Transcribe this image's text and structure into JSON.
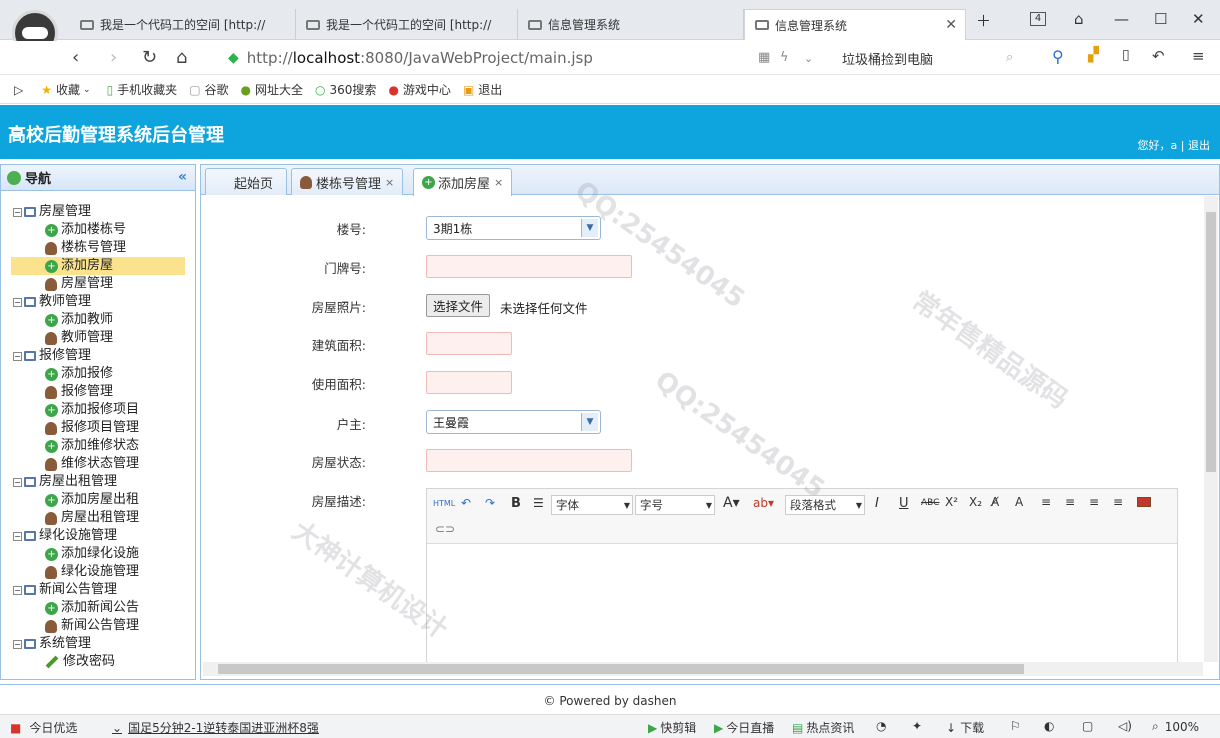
{
  "browser": {
    "tabs": [
      {
        "title": "我是一个代码工的空间 [http://"
      },
      {
        "title": "我是一个代码工的空间 [http://"
      },
      {
        "title": "信息管理系统"
      },
      {
        "title": "信息管理系统"
      }
    ],
    "tab_count": "4",
    "url_prefix": "http://",
    "url_host": "localhost",
    "url_rest": ":8080/JavaWebProject/main.jsp",
    "search_text": "垃圾桶捡到电脑"
  },
  "bookmarks": [
    "收藏",
    "手机收藏夹",
    "谷歌",
    "网址大全",
    "360搜索",
    "游戏中心",
    "退出"
  ],
  "app": {
    "title": "高校后勤管理系统后台管理",
    "user_info": "您好，a | 退出"
  },
  "nav": {
    "header": "导航",
    "items": [
      {
        "label": "房屋管理",
        "type": "group"
      },
      {
        "label": "添加楼栋号",
        "type": "add"
      },
      {
        "label": "楼栋号管理",
        "type": "manage"
      },
      {
        "label": "添加房屋",
        "type": "add",
        "selected": true
      },
      {
        "label": "房屋管理",
        "type": "manage"
      },
      {
        "label": "教师管理",
        "type": "group"
      },
      {
        "label": "添加教师",
        "type": "add"
      },
      {
        "label": "教师管理",
        "type": "manage"
      },
      {
        "label": "报修管理",
        "type": "group"
      },
      {
        "label": "添加报修",
        "type": "add"
      },
      {
        "label": "报修管理",
        "type": "manage"
      },
      {
        "label": "添加报修项目",
        "type": "add"
      },
      {
        "label": "报修项目管理",
        "type": "manage"
      },
      {
        "label": "添加维修状态",
        "type": "add"
      },
      {
        "label": "维修状态管理",
        "type": "manage"
      },
      {
        "label": "房屋出租管理",
        "type": "group"
      },
      {
        "label": "添加房屋出租",
        "type": "add"
      },
      {
        "label": "房屋出租管理",
        "type": "manage"
      },
      {
        "label": "绿化设施管理",
        "type": "group"
      },
      {
        "label": "添加绿化设施",
        "type": "add"
      },
      {
        "label": "绿化设施管理",
        "type": "manage"
      },
      {
        "label": "新闻公告管理",
        "type": "group"
      },
      {
        "label": "添加新闻公告",
        "type": "add"
      },
      {
        "label": "新闻公告管理",
        "type": "manage"
      },
      {
        "label": "系统管理",
        "type": "group"
      },
      {
        "label": "修改密码",
        "type": "edit"
      }
    ]
  },
  "content_tabs": [
    "起始页",
    "楼栋号管理",
    "添加房屋"
  ],
  "form": {
    "building_label": "楼号:",
    "building_value": "3期1栋",
    "door_label": "门牌号:",
    "photo_label": "房屋照片:",
    "file_button": "选择文件",
    "file_status": "未选择任何文件",
    "build_area_label": "建筑面积:",
    "use_area_label": "使用面积:",
    "owner_label": "户主:",
    "owner_value": "王曼霞",
    "status_label": "房屋状态:",
    "desc_label": "房屋描述:"
  },
  "editor": {
    "font_family": "字体",
    "font_size": "字号",
    "paragraph": "段落格式",
    "html": "HTML"
  },
  "footer": "© Powered by dashen",
  "statusbar": {
    "left": "今日优选",
    "news": "国足5分钟2-1逆转泰国进亚洲杯8强",
    "items": [
      "快剪辑",
      "今日直播",
      "热点资讯",
      "下载"
    ],
    "zoom": "100%"
  }
}
